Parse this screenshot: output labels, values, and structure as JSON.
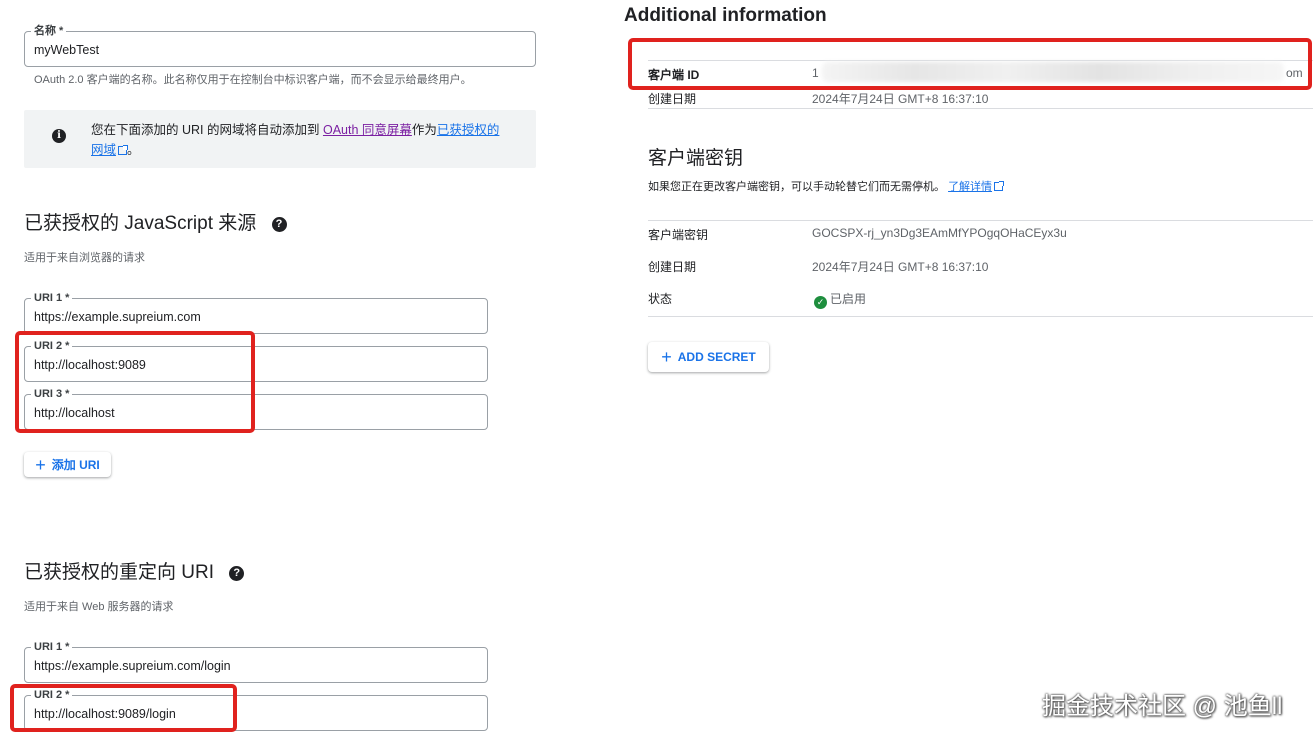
{
  "name_field": {
    "label": "名称 *",
    "value": "myWebTest",
    "helper": "OAuth 2.0 客户端的名称。此名称仅用于在控制台中标识客户端，而不会显示给最终用户。"
  },
  "info_notice": {
    "text_before": "您在下面添加的 URI 的网域将自动添加到",
    "consent_link": "OAuth 同意屏幕",
    "text_middle": "作为",
    "domains_link_part1": "已获授权的",
    "domains_link_part2": "网域",
    "text_after": "。"
  },
  "js_origins": {
    "title": "已获授权的 JavaScript 来源",
    "helper": "适用于来自浏览器的请求",
    "uris": [
      {
        "label": "URI 1 *",
        "value": "https://example.supreium.com"
      },
      {
        "label": "URI 2 *",
        "value": "http://localhost:9089"
      },
      {
        "label": "URI 3 *",
        "value": "http://localhost"
      }
    ],
    "add_button": "添加 URI"
  },
  "redirect_uris": {
    "title": "已获授权的重定向 URI",
    "helper": "适用于来自 Web 服务器的请求",
    "uris": [
      {
        "label": "URI 1 *",
        "value": "https://example.supreium.com/login"
      },
      {
        "label": "URI 2 *",
        "value": "http://localhost:9089/login"
      }
    ]
  },
  "additional_info": {
    "title": "Additional information",
    "client_id_label": "客户端 ID",
    "client_id_value_start": "1",
    "client_id_value_end": "om",
    "created_label": "创建日期",
    "created_value": "2024年7月24日 GMT+8 16:37:10"
  },
  "client_secret": {
    "title": "客户端密钥",
    "description": "如果您正在更改客户端密钥，可以手动轮替它们而无需停机。",
    "learn_more": "了解详情",
    "rows": {
      "secret_label": "客户端密钥",
      "secret_value": "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",
      "created_label": "创建日期",
      "created_value": "2024年7月24日 GMT+8 16:37:10",
      "status_label": "状态",
      "status_value": "已启用"
    },
    "add_secret_button": "ADD SECRET"
  },
  "watermark": "掘金技术社区 @ 池鱼ll",
  "colors": {
    "accent": "#1a73e8",
    "highlight_red": "#e0221e",
    "status_green": "#1e8e3e"
  }
}
